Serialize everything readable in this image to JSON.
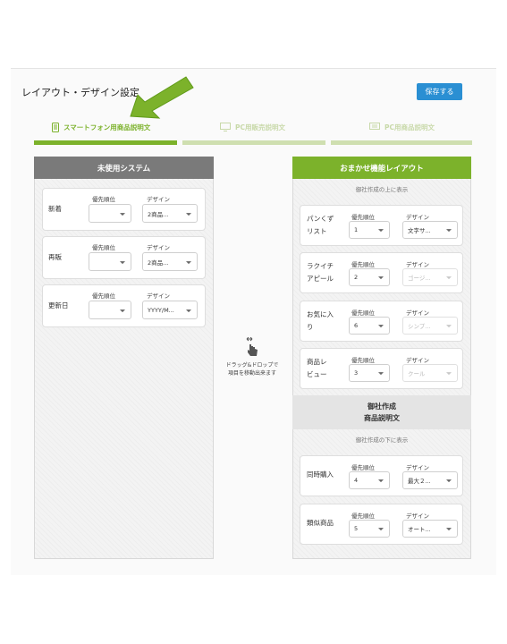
{
  "page": {
    "title": "レイアウト・デザイン設定",
    "save_label": "保存する"
  },
  "tabs": [
    {
      "label": "スマートフォン用商品説明文",
      "icon": "smartphone-icon",
      "active": true
    },
    {
      "label": "PC用販売説明文",
      "icon": "monitor-icon",
      "active": false
    },
    {
      "label": "PC用商品説明文",
      "icon": "document-icon",
      "active": false
    }
  ],
  "colors": {
    "accent": "#7cb22b",
    "save": "#2a8fd3",
    "unused_header": "#7a7a7a"
  },
  "unused": {
    "header": "未使用システム",
    "items": [
      {
        "label": "新着",
        "priority_label": "優先順位",
        "priority": "",
        "design_label": "デザイン",
        "design": "2商品..."
      },
      {
        "label": "再販",
        "priority_label": "優先順位",
        "priority": "",
        "design_label": "デザイン",
        "design": "2商品..."
      },
      {
        "label": "更新日",
        "priority_label": "優先順位",
        "priority": "",
        "design_label": "デザイン",
        "design": "YYYY/M..."
      }
    ]
  },
  "hint": {
    "icon": "drag-hand-icon",
    "line1": "ドラッグ&ドロップで",
    "line2": "項目を移動出来ます"
  },
  "layout": {
    "header": "おまかせ機能レイアウト",
    "above_text": "御社作成の上に表示",
    "above_items": [
      {
        "label_l1": "パンくず",
        "label_l2": "リスト",
        "priority_label": "優先順位",
        "priority": "1",
        "design_label": "デザイン",
        "design": "文字サ..."
      },
      {
        "label_l1": "ラクイチ",
        "label_l2": "アピール",
        "priority_label": "優先順位",
        "priority": "2",
        "design_label": "デザイン",
        "design": "ゴージ..."
      },
      {
        "label_l1": "お気に入",
        "label_l2": "り",
        "priority_label": "優先順位",
        "priority": "6",
        "design_label": "デザイン",
        "design": "シンプ..."
      },
      {
        "label_l1": "商品レ",
        "label_l2": "ビュー",
        "priority_label": "優先順位",
        "priority": "3",
        "design_label": "デザイン",
        "design": "クール"
      }
    ],
    "company_block_l1": "御社作成",
    "company_block_l2": "商品説明文",
    "below_text": "御社作成の下に表示",
    "below_items": [
      {
        "label_l1": "同時購入",
        "label_l2": "",
        "priority_label": "優先順位",
        "priority": "4",
        "design_label": "デザイン",
        "design": "最大２..."
      },
      {
        "label_l1": "類似商品",
        "label_l2": "",
        "priority_label": "優先順位",
        "priority": "5",
        "design_label": "デザイン",
        "design": "オート..."
      }
    ]
  }
}
